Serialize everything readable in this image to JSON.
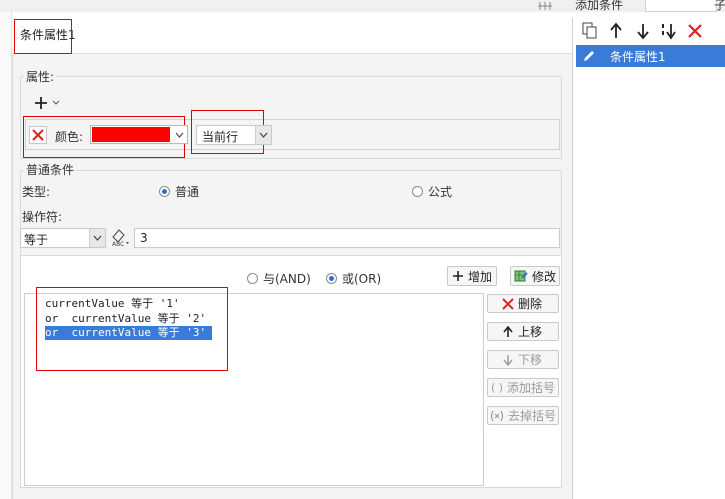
{
  "top": {
    "tab_label": "添加条件",
    "corner_glyph": "子"
  },
  "dialog": {
    "title": "条件属性1"
  },
  "property": {
    "section_label": "属性:",
    "color_label": "颜色:",
    "color_value": "#ff0000",
    "scope_value": "当前行"
  },
  "condition": {
    "section_label": "普通条件",
    "type_label": "类型:",
    "type_normal": "普通",
    "type_formula": "公式",
    "operator_label": "操作符:",
    "operator_value": "等于",
    "value": "3",
    "and_label": "与(AND)",
    "or_label": "或(OR)",
    "add_button": "增加",
    "modify_button": "修改",
    "delete_button": "删除",
    "move_up_button": "上移",
    "move_down_button": "下移",
    "add_bracket_button": "添加括号",
    "remove_bracket_button": "去掉括号",
    "list": [
      "currentValue 等于 '1'",
      "or  currentValue 等于 '2'",
      "or  currentValue 等于 '3'"
    ]
  },
  "right_panel": {
    "items": [
      "条件属性1"
    ]
  }
}
